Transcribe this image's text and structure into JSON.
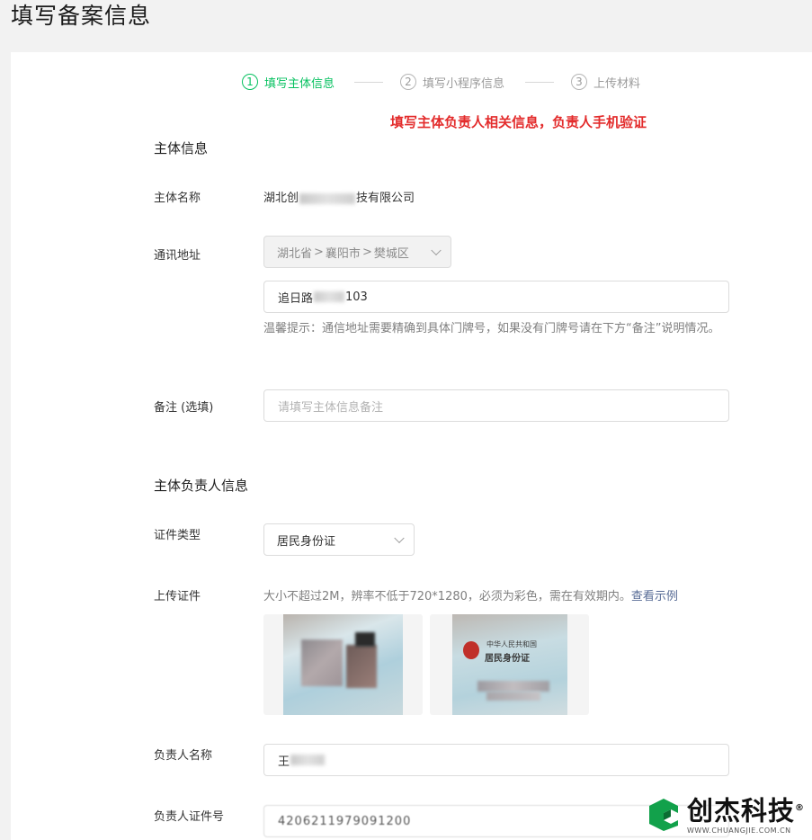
{
  "page": {
    "title": "填写备案信息"
  },
  "stepper": [
    {
      "number": "1",
      "label": "填写主体信息",
      "active": true
    },
    {
      "number": "2",
      "label": "填写小程序信息",
      "active": false
    },
    {
      "number": "3",
      "label": "上传材料",
      "active": false
    }
  ],
  "annotation": "填写主体负责人相关信息，负责人手机验证",
  "entity_section": {
    "title": "主体信息",
    "name_label": "主体名称",
    "name_prefix": "湖北创",
    "name_suffix": "技有限公司",
    "address_label": "通讯地址",
    "region": {
      "province": "湖北省",
      "city": "襄阳市",
      "district": "樊城区"
    },
    "address_detail": "追日路",
    "address_detail_end": "103",
    "address_hint": "温馨提示：通信地址需要精确到具体门牌号，如果没有门牌号请在下方“备注”说明情况。",
    "remark_label": "备注 (选填)",
    "remark_placeholder": "请填写主体信息备注"
  },
  "person_section": {
    "title": "主体负责人信息",
    "id_type_label": "证件类型",
    "id_type_value": "居民身份证",
    "upload_label": "上传证件",
    "upload_hint": "大小不超过2M，辨率不低于720*1280，必须为彩色，需在有效期内。",
    "upload_example_link": "查看示例",
    "id_card_back_title": "中华人民共和国",
    "id_card_back_subtitle": "居民身份证",
    "person_name_label": "负责人名称",
    "person_name_value": "王",
    "person_id_label": "负责人证件号",
    "person_id_value": "4206211979091200"
  },
  "watermark": {
    "name": "创杰科技",
    "url": "WWW.CHUANGJIE.COM.CN",
    "registered": "®"
  },
  "colors": {
    "accent": "#07c160",
    "annotation": "#e32c2c",
    "link": "#576b95"
  }
}
